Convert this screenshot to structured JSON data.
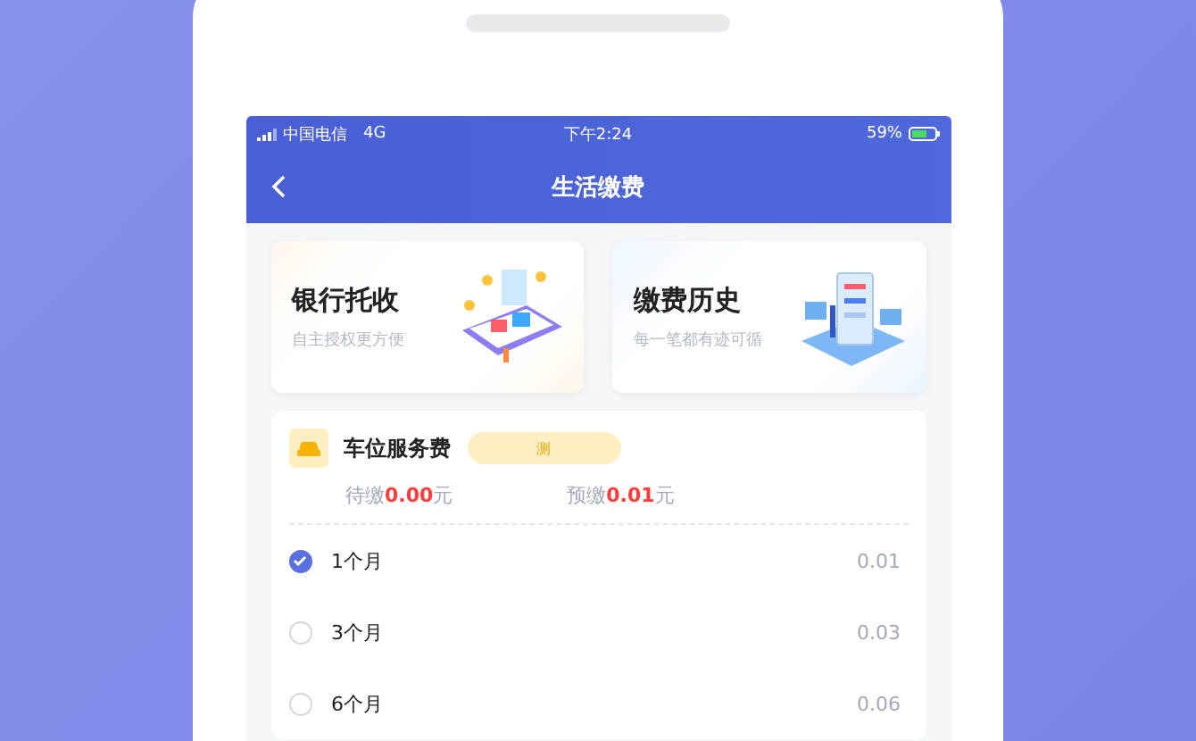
{
  "status_bar": {
    "carrier": "中国电信",
    "network": "4G",
    "time": "下午2:24",
    "battery": "59%"
  },
  "nav": {
    "title": "生活缴费"
  },
  "shortcuts": [
    {
      "kind": "bank",
      "title": "银行托收",
      "subtitle": "自主授权更方便"
    },
    {
      "kind": "history",
      "title": "缴费历史",
      "subtitle": "每一笔都有迹可循"
    }
  ],
  "service": {
    "name": "车位服务费",
    "tag": "测",
    "due_label": "待缴",
    "due_amount": "0.00",
    "due_unit": "元",
    "prepaid_label": "预缴",
    "prepaid_amount": "0.01",
    "prepaid_unit": "元"
  },
  "options": [
    {
      "label": "1个月",
      "price": "0.01",
      "selected": true
    },
    {
      "label": "3个月",
      "price": "0.03",
      "selected": false
    },
    {
      "label": "6个月",
      "price": "0.06",
      "selected": false
    }
  ]
}
